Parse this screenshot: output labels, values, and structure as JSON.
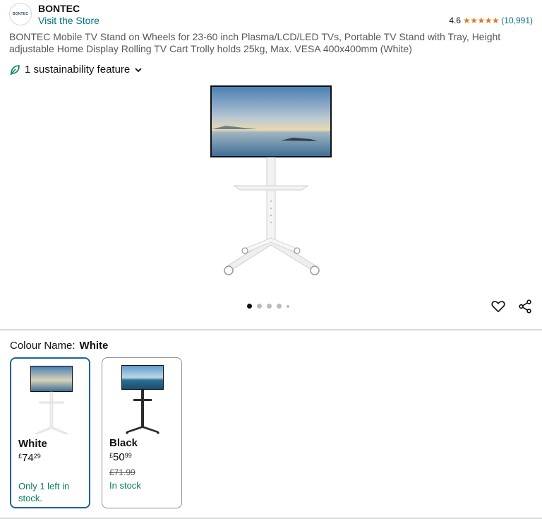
{
  "header": {
    "logo_text": "BONTEC",
    "brand": "BONTEC",
    "store_link": "Visit the Store",
    "rating_value": "4.6",
    "rating_stars": "★★★★★",
    "rating_count": "(10,991)"
  },
  "product": {
    "title": "BONTEC Mobile TV Stand on Wheels for 23-60 inch Plasma/LCD/LED TVs, Portable TV Stand with Tray, Height adjustable Home Display Rolling TV Cart Trolly holds 25kg, Max. VESA 400x400mm (White)",
    "sustainability": "1 sustainability feature"
  },
  "gallery": {
    "image_count": 5,
    "active_index": 0
  },
  "colour": {
    "label": "Colour Name:",
    "selected": "White",
    "options": [
      {
        "name": "White",
        "currency": "£",
        "price_whole": "74",
        "price_fraction": "29",
        "old_price": "",
        "stock": "Only 1 left in stock.",
        "stand_color": "#f0f0f0"
      },
      {
        "name": "Black",
        "currency": "£",
        "price_whole": "50",
        "price_fraction": "99",
        "old_price": "£71.99",
        "stock": "In stock",
        "stand_color": "#2a2a2a"
      }
    ]
  },
  "colors": {
    "link": "#007185",
    "stars": "#de7921",
    "stock": "#067d62",
    "selected_border": "#2162a1"
  }
}
